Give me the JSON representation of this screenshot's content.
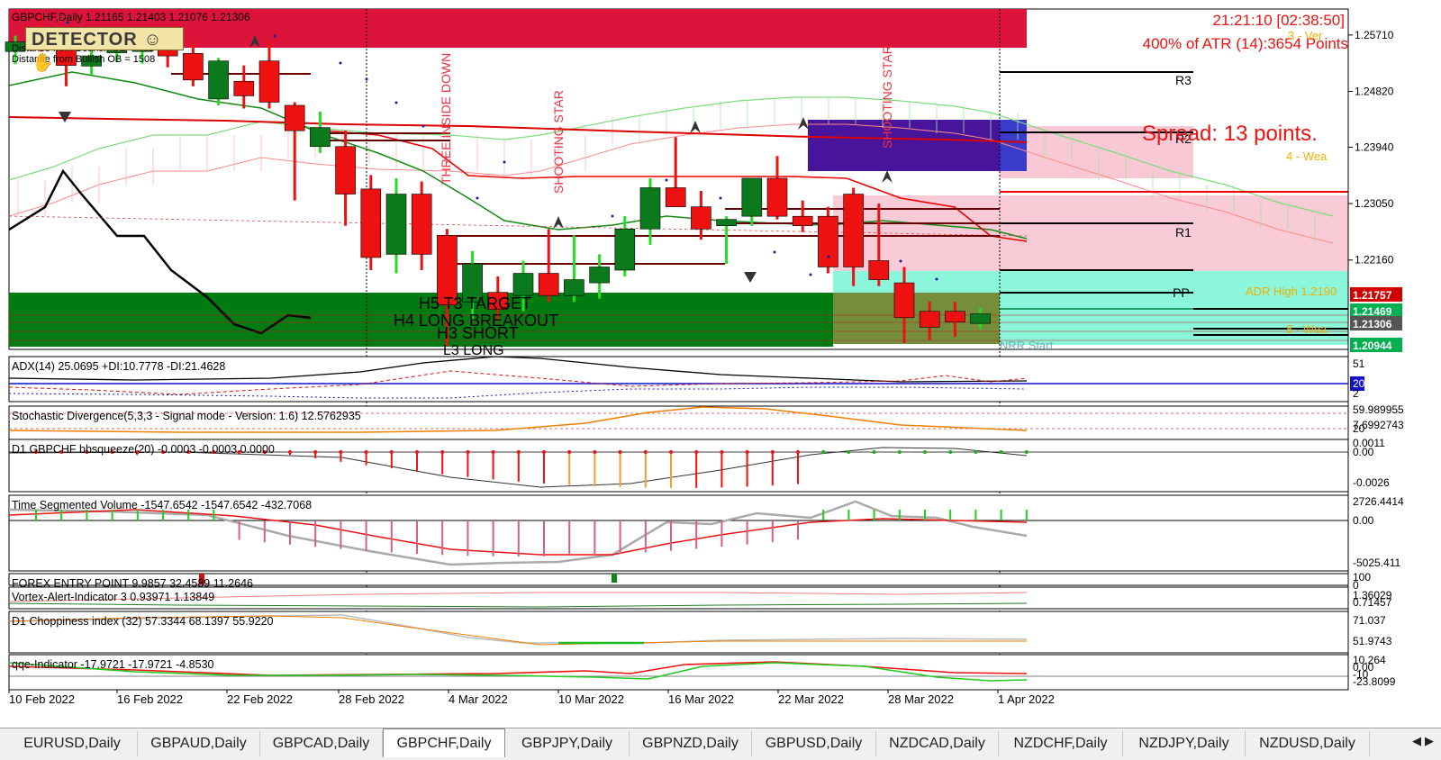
{
  "header": {
    "symbol_line": "GBPCHF,Daily  1.21165 1.21403 1.21076 1.21306",
    "info_line_1": "Distance from Bearish OB = 451",
    "info_line_2": "Distance from Bullish OB = 1508",
    "detector_label": "DETECTOR",
    "clock": "21:21:10 [02:38:50]",
    "atr_text": "400% of ATR (14):3654 Points",
    "spread_text": "Spread: 13 points.",
    "week_label_top": "3 - Ver",
    "week_label_mid": "4 - Wea",
    "week_label_low": "8 - Wea",
    "adr_high_label": "ADR High 1.2190",
    "nrr_label": "NRR Start"
  },
  "annotations": {
    "vertical_texts": [
      "THREE INSIDE DOWN",
      "SHOOTING STAR",
      "SHOOTING STAR"
    ],
    "zone_texts": [
      "H5 T3 TARGET",
      "H4 LONG BREAKOUT",
      "H3 SHORT",
      "L3 LONG"
    ],
    "pivot_labels": [
      "R3",
      "R2",
      "R1",
      "PP"
    ]
  },
  "colors": {
    "bull": "#0a7a1c",
    "bear": "#ee1111",
    "bull_bright": "#22dd22",
    "bear_dark": "#8b0000",
    "kumo_line": "#7ddc7d",
    "pink_zone": "#f7c2cf",
    "aqua_zone": "#7ff5d6",
    "green_zone": "#007b12",
    "purple_box": "#48149c",
    "red_band": "#dc143c"
  },
  "price_axis": {
    "labels": [
      "1.25710",
      "1.24820",
      "1.23940",
      "1.23050",
      "1.22160"
    ],
    "tags": [
      {
        "text": "1.21757",
        "bg": "#d00000",
        "fg": "#ffffff"
      },
      {
        "text": "1.21469",
        "bg": "#00b050",
        "fg": "#ffffff"
      },
      {
        "text": "1.21306",
        "bg": "#555555",
        "fg": "#ffffff"
      },
      {
        "text": "1.20944",
        "bg": "#00b050",
        "fg": "#ffffff"
      }
    ]
  },
  "chart_data": {
    "type": "candlestick",
    "symbol": "GBPCHF",
    "timeframe": "Daily",
    "ylim": [
      1.2075,
      1.2612
    ],
    "price_levels": [
      1.2571,
      1.2482,
      1.2394,
      1.2305,
      1.2216
    ],
    "candles": [
      {
        "o": 1.2545,
        "h": 1.257,
        "l": 1.2525,
        "c": 1.256
      },
      {
        "o": 1.257,
        "h": 1.2605,
        "l": 1.2545,
        "c": 1.2555
      },
      {
        "o": 1.2552,
        "h": 1.2583,
        "l": 1.249,
        "c": 1.2523
      },
      {
        "o": 1.2522,
        "h": 1.2548,
        "l": 1.2508,
        "c": 1.2538
      },
      {
        "o": 1.2543,
        "h": 1.2572,
        "l": 1.2528,
        "c": 1.2555
      },
      {
        "o": 1.2545,
        "h": 1.2576,
        "l": 1.2526,
        "c": 1.2552
      },
      {
        "o": 1.2548,
        "h": 1.257,
        "l": 1.252,
        "c": 1.2538
      },
      {
        "o": 1.2542,
        "h": 1.256,
        "l": 1.249,
        "c": 1.25
      },
      {
        "o": 1.247,
        "h": 1.2535,
        "l": 1.246,
        "c": 1.253
      },
      {
        "o": 1.2498,
        "h": 1.2523,
        "l": 1.2455,
        "c": 1.2475
      },
      {
        "o": 1.253,
        "h": 1.2565,
        "l": 1.2455,
        "c": 1.2465
      },
      {
        "o": 1.246,
        "h": 1.2465,
        "l": 1.231,
        "c": 1.242
      },
      {
        "o": 1.2395,
        "h": 1.245,
        "l": 1.2385,
        "c": 1.2425
      },
      {
        "o": 1.2395,
        "h": 1.242,
        "l": 1.227,
        "c": 1.232
      },
      {
        "o": 1.2328,
        "h": 1.235,
        "l": 1.22,
        "c": 1.222
      },
      {
        "o": 1.2225,
        "h": 1.2345,
        "l": 1.2195,
        "c": 1.232
      },
      {
        "o": 1.232,
        "h": 1.234,
        "l": 1.22,
        "c": 1.2225
      },
      {
        "o": 1.2255,
        "h": 1.2265,
        "l": 1.208,
        "c": 1.2145
      },
      {
        "o": 1.215,
        "h": 1.223,
        "l": 1.212,
        "c": 1.221
      },
      {
        "o": 1.2165,
        "h": 1.219,
        "l": 1.212,
        "c": 1.2138
      },
      {
        "o": 1.216,
        "h": 1.2215,
        "l": 1.2135,
        "c": 1.2195
      },
      {
        "o": 1.2195,
        "h": 1.2265,
        "l": 1.215,
        "c": 1.216
      },
      {
        "o": 1.216,
        "h": 1.2255,
        "l": 1.215,
        "c": 1.2185
      },
      {
        "o": 1.218,
        "h": 1.2225,
        "l": 1.2155,
        "c": 1.2205
      },
      {
        "o": 1.22,
        "h": 1.2285,
        "l": 1.219,
        "c": 1.2265
      },
      {
        "o": 1.2265,
        "h": 1.2345,
        "l": 1.224,
        "c": 1.233
      },
      {
        "o": 1.233,
        "h": 1.241,
        "l": 1.2305,
        "c": 1.23
      },
      {
        "o": 1.23,
        "h": 1.2325,
        "l": 1.2248,
        "c": 1.2265
      },
      {
        "o": 1.227,
        "h": 1.2285,
        "l": 1.221,
        "c": 1.228
      },
      {
        "o": 1.2285,
        "h": 1.233,
        "l": 1.227,
        "c": 1.2345
      },
      {
        "o": 1.2345,
        "h": 1.238,
        "l": 1.228,
        "c": 1.2285
      },
      {
        "o": 1.2285,
        "h": 1.231,
        "l": 1.226,
        "c": 1.227
      },
      {
        "o": 1.2285,
        "h": 1.23,
        "l": 1.2195,
        "c": 1.2205
      },
      {
        "o": 1.232,
        "h": 1.233,
        "l": 1.2175,
        "c": 1.2205
      },
      {
        "o": 1.2215,
        "h": 1.2305,
        "l": 1.2175,
        "c": 1.2185
      },
      {
        "o": 1.218,
        "h": 1.2205,
        "l": 1.2085,
        "c": 1.2125
      },
      {
        "o": 1.2135,
        "h": 1.215,
        "l": 1.209,
        "c": 1.211
      },
      {
        "o": 1.2135,
        "h": 1.215,
        "l": 1.2095,
        "c": 1.2118
      },
      {
        "o": 1.2116,
        "h": 1.214,
        "l": 1.2107,
        "c": 1.2131
      }
    ],
    "x_labels": [
      "10 Feb 2022",
      "16 Feb 2022",
      "22 Feb 2022",
      "28 Feb 2022",
      "4 Mar 2022",
      "10 Mar 2022",
      "16 Mar 2022",
      "22 Mar 2022",
      "28 Mar 2022",
      "1 Apr 2022"
    ],
    "subpanels": [
      {
        "label": "ADX(14) 25.0695 +DI:10.7778 -DI:21.4628",
        "levels": [
          "51",
          "20",
          "2"
        ]
      },
      {
        "label": "Stochastic Divergence(5,3,3 - Signal mode - Version: 1.6) 12.5762935",
        "levels": [
          "59.989955",
          "7.6992743",
          "20"
        ]
      },
      {
        "label": "D1 GBPCHF bbsqueeze(20) -0.0003 -0.0003 0.0000",
        "levels": [
          "0.0011",
          "0.00",
          "-0.0026"
        ]
      },
      {
        "label": "Time Segmented Volume -1547.6542 -1547.6542 -432.7068",
        "levels": [
          "2726.4414",
          "0.00",
          "-5025.411"
        ]
      },
      {
        "label": "FOREX ENTRY POINT 9.9857 32.4589 11.2646",
        "levels": [
          "100",
          "0"
        ]
      },
      {
        "label": "Vortex-Alert-Indicator 3 0.93971 1.13849",
        "levels": [
          "1.36029",
          "0.71457"
        ]
      },
      {
        "label": "D1 Choppiness index (32) 57.3344 68.1397 55.9220",
        "levels": [
          "71.037",
          "51.9743"
        ]
      },
      {
        "label": "qqe-Indicator -17.9721 -17.9721 -4.8530",
        "levels": [
          "10.264",
          "0.00",
          "-10",
          "-23.8099"
        ]
      }
    ]
  },
  "tabs": [
    {
      "label": "EURUSD,Daily",
      "active": false
    },
    {
      "label": "GBPAUD,Daily",
      "active": false
    },
    {
      "label": "GBPCAD,Daily",
      "active": false
    },
    {
      "label": "GBPCHF,Daily",
      "active": true
    },
    {
      "label": "GBPJPY,Daily",
      "active": false
    },
    {
      "label": "GBPNZD,Daily",
      "active": false
    },
    {
      "label": "GBPUSD,Daily",
      "active": false
    },
    {
      "label": "NZDCAD,Daily",
      "active": false
    },
    {
      "label": "NZDCHF,Daily",
      "active": false
    },
    {
      "label": "NZDJPY,Daily",
      "active": false
    },
    {
      "label": "NZDUSD,Daily",
      "active": false
    }
  ],
  "nav": {
    "left": "◀",
    "right": "▶"
  }
}
